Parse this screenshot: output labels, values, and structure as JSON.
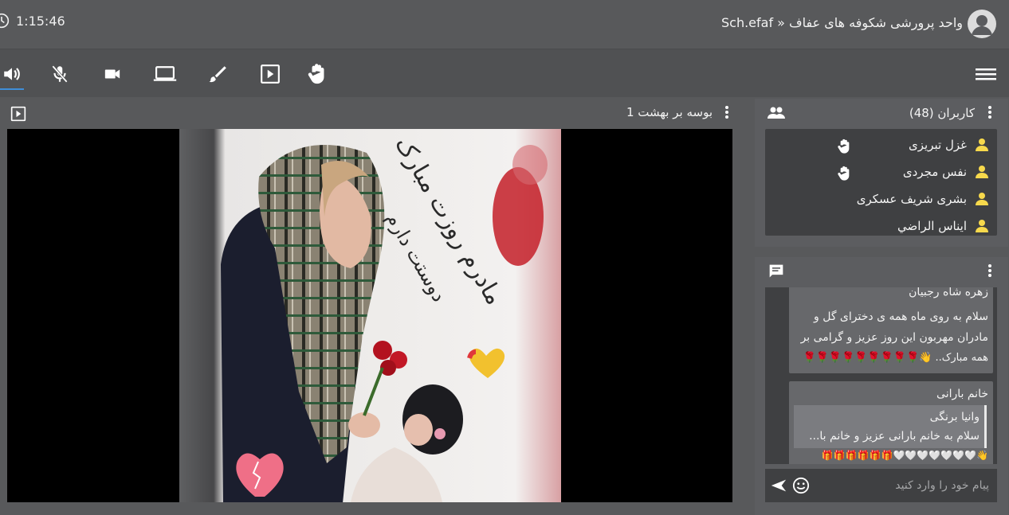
{
  "header": {
    "timer": "1:15:46",
    "title": "Sch.efaf » واحد پرورشی شکوفه های عفاف",
    "avatar_icon": "user-avatar-icon",
    "clock_icon": "clock-icon"
  },
  "toolbar": {
    "items": [
      {
        "name": "speaker-icon",
        "active": true
      },
      {
        "name": "mic-off-icon",
        "active": false
      },
      {
        "name": "camera-icon",
        "active": false
      },
      {
        "name": "screen-share-icon",
        "active": false
      },
      {
        "name": "brush-icon",
        "active": false
      },
      {
        "name": "play-media-icon",
        "active": false
      },
      {
        "name": "raise-hand-icon",
        "active": false
      }
    ],
    "menu_icon": "hamburger-menu-icon"
  },
  "video": {
    "title": "بوسه بر بهشت 1",
    "frame_text_line1": "مادرم روزت مبارک",
    "frame_text_line2": "دوستت دارم"
  },
  "users": {
    "header": "کاربران (48)",
    "list": [
      {
        "name": "غزل تبریزی",
        "hand": true
      },
      {
        "name": "نفس مجردی",
        "hand": true
      },
      {
        "name": "بشری شریف عسکری",
        "hand": false
      },
      {
        "name": "ایناس الراضي",
        "hand": false
      }
    ]
  },
  "chat": {
    "messages": [
      {
        "sender": "زهره شاه رجبیان",
        "text_line1": "سلام به روی ماه همه ی دختر‌ای گل و",
        "text_line2": "مادران مهربون این روز عزیز و گرامی بر",
        "text_line3": "همه مبارک.. 👋🌹🌹🌹🌹🌹🌹🌹🌹🌹"
      },
      {
        "sender": "خانم بارانی",
        "quote_sender": "وانیا برنگی",
        "quote_text": "سلام به خانم بارانی عزیز و خانم با...",
        "text": "👋🤍🤍🤍🤍🤍🤍🤍🎁🎁🎁🎁🎁🎁"
      }
    ],
    "placeholder": "پیام خود را وارد کنید"
  },
  "colors": {
    "background": "#58595b",
    "accent": "#3f8ed8",
    "user_icon": "#f7d94c"
  }
}
